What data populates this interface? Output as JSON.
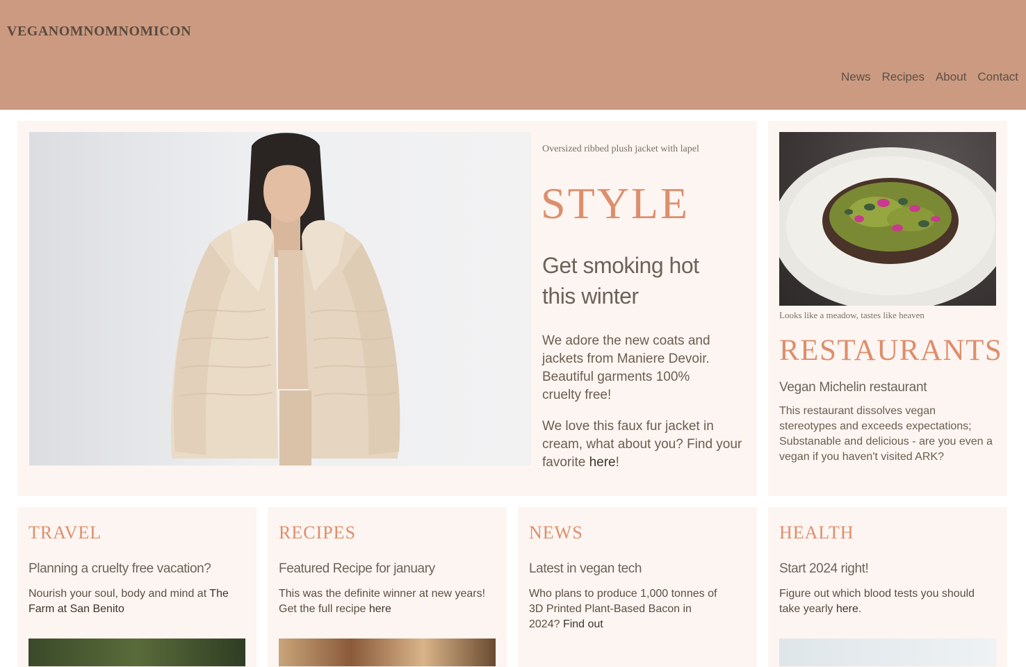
{
  "site": {
    "logo": "VEGANOMNOMNOMICON"
  },
  "nav": {
    "items": [
      "News",
      "Recipes",
      "About",
      "Contact"
    ]
  },
  "hero": {
    "caption": "Oversized ribbed plush jacket with lapel",
    "title": "STYLE",
    "subtitle": "Get smoking hot this winter",
    "paragraph1": "We adore the new coats and jackets from Maniere Devoir. Beautiful garments 100% cruelty free!",
    "paragraph2_pre": "We love this faux fur jacket in cream, what about you? Find your favorite ",
    "paragraph2_link": "here",
    "paragraph2_post": "!"
  },
  "restaurants": {
    "caption": "Looks like a meadow, tastes like heaven",
    "title": "RESTAURANTS",
    "subtitle": "Vegan Michelin restaurant",
    "body": "This restaurant dissolves vegan stereotypes and exceeds expectations; Substanable and delicious - are you even a vegan if you haven't visited ARK?"
  },
  "sections": [
    {
      "title": "TRAVEL",
      "subtitle": "Planning a cruelty free vacation?",
      "pre": "Nourish your soul, body and mind at ",
      "link": "The Farm at San Benito",
      "post": ""
    },
    {
      "title": "RECIPES",
      "subtitle": "Featured Recipe for january",
      "pre": "This was the definite winner at new years! Get the full recipe ",
      "link": "here",
      "post": ""
    },
    {
      "title": "NEWS",
      "subtitle": "Latest in vegan tech",
      "pre": "Who plans to produce 1,000 tonnes of 3D Printed Plant-Based Bacon in 2024? ",
      "link": "Find out",
      "post": ""
    },
    {
      "title": "HEALTH",
      "subtitle": "Start 2024 right!",
      "pre": "Figure out which blood tests you should take yearly ",
      "link": "here",
      "post": "."
    }
  ],
  "colors": {
    "header": "#cb9a80",
    "card": "#fdf5f1",
    "accent": "#dd8e6c"
  }
}
